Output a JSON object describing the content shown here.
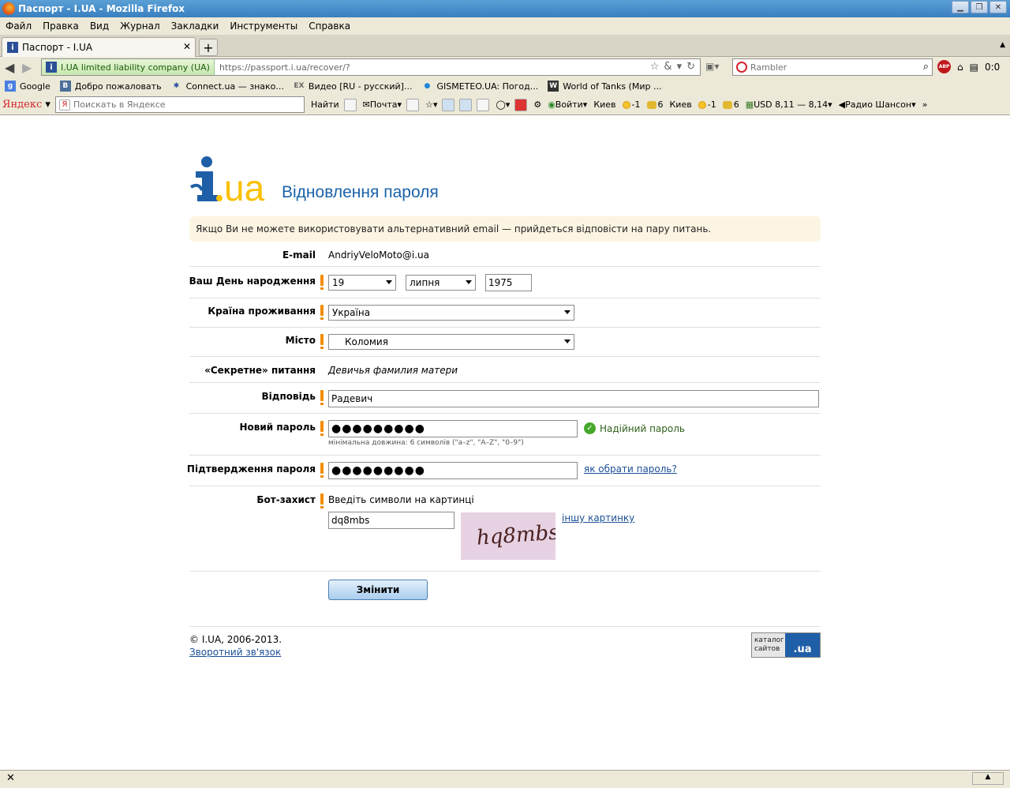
{
  "window": {
    "title": "Паспорт - I.UA  - Mozilla Firefox"
  },
  "menu": [
    "Файл",
    "Правка",
    "Вид",
    "Журнал",
    "Закладки",
    "Инструменты",
    "Справка"
  ],
  "tab": {
    "title": "Паспорт - I.UA"
  },
  "navbar": {
    "identity": "I.UA limited liability company (UA)",
    "url": "https://passport.i.ua/recover/?",
    "search_placeholder": "Rambler",
    "counter": "0:0"
  },
  "bookmarks": [
    "Google",
    "Добро пожаловать",
    "Connect.ua — знако...",
    "Видео [RU - русский]...",
    "GISMETEO.UA: Погод...",
    "World of Tanks (Мир ..."
  ],
  "yandex": {
    "brand": "Яндекс",
    "search_placeholder": "Поискать в Яндексе",
    "find": "Найти",
    "mail": "Почта",
    "login": "Войти",
    "city1": "Киев",
    "temp1": "-1",
    "temp2": "6",
    "city2": "Киев",
    "temp3": "-1",
    "temp4": "6",
    "usd": "USD 8,11 — 8,14",
    "radio": "Радио Шансон"
  },
  "page": {
    "title": "Відновлення пароля",
    "notice": "Якщо Ви не можете використовувати альтернативний email — прийдеться відповісти на пару питань.",
    "email_label": "E-mail",
    "email_value": "AndriyVeloMoto@i.ua",
    "birthday_label": "Ваш День народження",
    "birth_day": "19",
    "birth_month": "липня",
    "birth_year": "1975",
    "country_label": "Країна проживання",
    "country": "Україна",
    "city_label": "Місто",
    "city": "Коломия",
    "secret_label": "«Секретне» питання",
    "secret_question": "Девичья фамилия матери",
    "answer_label": "Відповідь",
    "answer": "Радевич",
    "new_pass_label": "Новий пароль",
    "new_pass": "●●●●●●●●●",
    "strong_pass": "Надійний пароль",
    "pass_hint": "мінімальна довжина: 6 символів (\"a–z\", \"A–Z\", \"0–9\")",
    "confirm_label": "Підтвердження пароля",
    "confirm_pass": "●●●●●●●●●",
    "choose_pass_link": "як обрати пароль?",
    "bot_label": "Бот-захист",
    "bot_instruction": "Введіть символи на картинці",
    "captcha_input": "dq8mbs",
    "captcha_text": "hq8mbs",
    "other_image": "іншу картинку",
    "submit": "Змінити"
  },
  "footer": {
    "copyright": "© I.UA, 2006-2013.",
    "feedback": "Зворотний зв'язок",
    "catalog_line1": "каталог",
    "catalog_line2": "сайтов",
    "catalog_logo": ".ua"
  },
  "colors": {
    "title_blue": "#1b63a8",
    "required_orange": "#f28c00",
    "notice_bg": "#fdf5e3",
    "logo_yellow": "#f9c000",
    "logo_blue": "#1f5fa7"
  }
}
